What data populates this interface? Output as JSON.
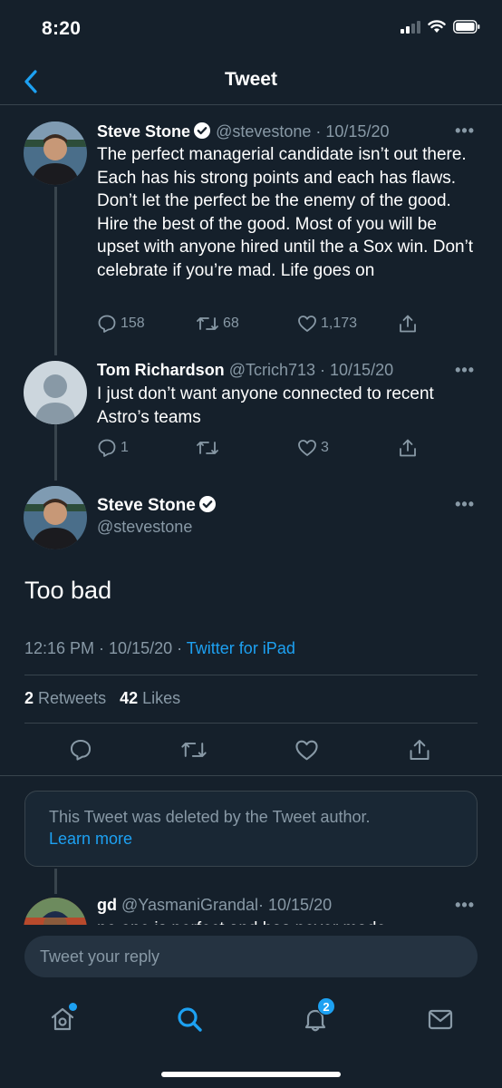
{
  "status": {
    "time": "8:20"
  },
  "nav": {
    "title": "Tweet"
  },
  "thread": [
    {
      "name": "Steve Stone",
      "verified": true,
      "handle": "@stevestone",
      "date": "· 10/15/20",
      "text": "The perfect managerial candidate isn’t out there. Each has his strong points and each has flaws. Don’t let the perfect be the enemy of the good. Hire the best of the good. Most of you will be upset with anyone hired until the a Sox win. Don’t celebrate if you’re mad. Life goes on",
      "replies": "158",
      "retweets": "68",
      "likes": "1,173"
    },
    {
      "name": "Tom Richardson",
      "verified": false,
      "handle": "@Tcrich713",
      "date": "· 10/15/20",
      "text": "I just don’t want anyone connected to recent Astro’s teams",
      "replies": "1",
      "retweets": "",
      "likes": "3"
    }
  ],
  "main_tweet": {
    "name": "Steve Stone",
    "handle": "@stevestone",
    "text": "Too bad",
    "time": "12:16 PM",
    "date": "10/15/20",
    "source": "Twitter for iPad",
    "retweet_count": "2",
    "retweet_label": "Retweets",
    "like_count": "42",
    "like_label": "Likes"
  },
  "deleted_notice": {
    "text": "This Tweet was deleted by the Tweet author.",
    "link": "Learn more"
  },
  "next_reply": {
    "name": "gd",
    "handle": "@YasmaniGrandal",
    "date": "· 10/15/20",
    "text": "no one is perfect and has never made"
  },
  "composer": {
    "placeholder": "Tweet your reply"
  },
  "tabs": {
    "notifications_badge": "2"
  },
  "colors": {
    "background": "#15202b",
    "accent": "#1da1f2",
    "muted": "#8899a6",
    "border": "#38444d"
  },
  "more_label": "•••"
}
